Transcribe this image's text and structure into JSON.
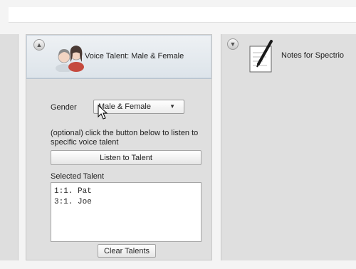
{
  "left_panel": {},
  "voice_panel": {
    "title": "Voice Talent: Male & Female",
    "gender_label": "Gender",
    "gender_value": "Male & Female",
    "help_text": "(optional) click the button below to listen to specific voice talent",
    "listen_button": "Listen to Talent",
    "selected_label": "Selected Talent",
    "selected_talents": [
      "1:1. Pat",
      "3:1. Joe"
    ],
    "clear_button": "Clear Talents"
  },
  "notes_panel": {
    "title": "Notes for Spectrio"
  },
  "icons": {
    "voice_panel_toggle": "collapse-up-icon",
    "notes_panel_toggle": "collapse-down-icon",
    "talent": "people-icon",
    "notes": "notepad-pen-icon",
    "dropdown": "chevron-down-icon",
    "cursor": "mouse-cursor-icon"
  }
}
